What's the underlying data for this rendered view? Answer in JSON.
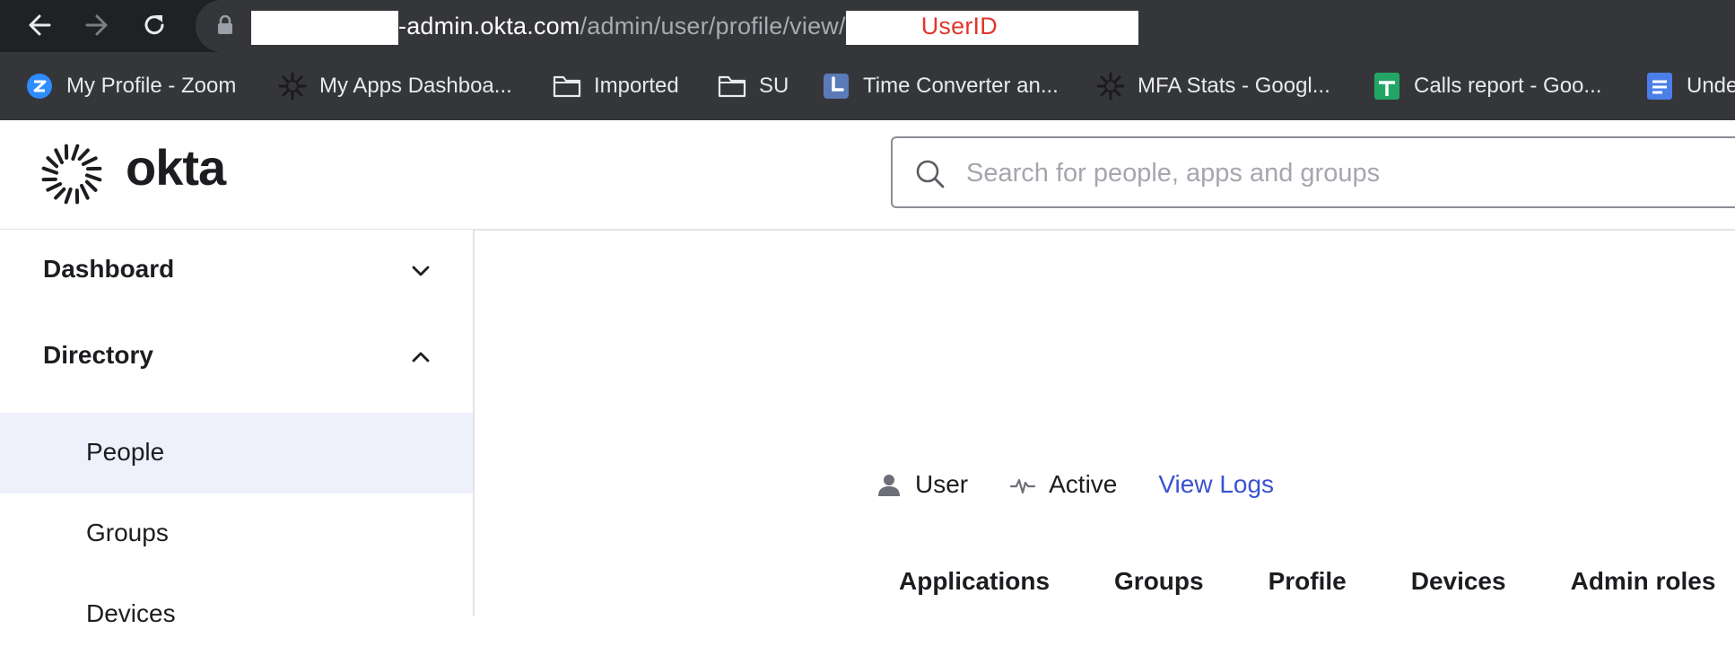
{
  "browser": {
    "url": {
      "host_suffix": "-admin.okta.com",
      "path": "/admin/user/profile/view/",
      "redacted_label": "UserID"
    },
    "bookmarks": [
      {
        "label": "My Profile - Zoom",
        "icon": "zoom-icon"
      },
      {
        "label": "My Apps Dashboa...",
        "icon": "okta-icon"
      },
      {
        "label": "Imported",
        "icon": "folder-icon"
      },
      {
        "label": "SU",
        "icon": "folder-icon"
      },
      {
        "label": "Time Converter an...",
        "icon": "clock-icon"
      },
      {
        "label": "MFA Stats - Googl...",
        "icon": "okta-icon"
      },
      {
        "label": "Calls report - Goo...",
        "icon": "sheets-icon"
      },
      {
        "label": "Unde",
        "icon": "docs-icon"
      }
    ]
  },
  "header": {
    "brand": "okta",
    "search_placeholder": "Search for people, apps and groups"
  },
  "sidebar": {
    "sections": [
      {
        "label": "Dashboard",
        "expanded": false
      },
      {
        "label": "Directory",
        "expanded": true
      }
    ],
    "directory_items": [
      "People",
      "Groups",
      "Devices"
    ]
  },
  "main": {
    "user_type": "User",
    "status": "Active",
    "view_logs": "View Logs",
    "tabs": [
      "Applications",
      "Groups",
      "Profile",
      "Devices",
      "Admin roles"
    ]
  },
  "colors": {
    "chrome_dark": "#202124",
    "chrome_bar": "#35363a",
    "link": "#3a52d1",
    "active_nav_bg": "#eef1fc",
    "redaction_text": "#e2362c"
  }
}
